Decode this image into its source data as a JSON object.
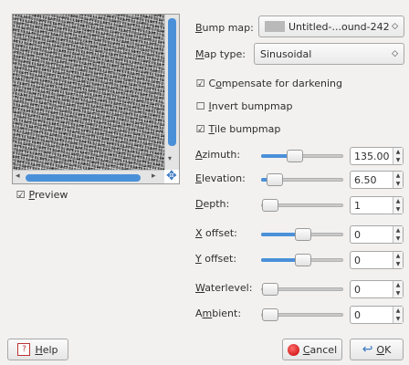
{
  "preview": {
    "checkbox_mark": "☑",
    "label_u": "P",
    "label_rest": "review"
  },
  "bump_map": {
    "label_u": "B",
    "label_rest": "ump map:",
    "value": "Untitled-...ound-242",
    "arrow": "◇"
  },
  "map_type": {
    "label_u": "M",
    "label_rest": "ap type:",
    "value": "Sinusoidal",
    "arrow": "◇"
  },
  "options": [
    {
      "mark": "☑",
      "pre": "C",
      "u": "o",
      "post": "mpensate for darkening"
    },
    {
      "mark": "☐",
      "pre": "",
      "u": "I",
      "post": "nvert bumpmap"
    },
    {
      "mark": "☑",
      "pre": "",
      "u": "T",
      "post": "ile bumpmap"
    }
  ],
  "params": [
    {
      "pre": "",
      "u": "A",
      "post": "zimuth:",
      "value": "135.00",
      "level": 0.38
    },
    {
      "pre": "",
      "u": "E",
      "post": "levation:",
      "value": "6.50",
      "level": 0.07
    },
    {
      "pre": "",
      "u": "D",
      "post": "epth:",
      "value": "1",
      "level": 0.0
    },
    {
      "pre": "",
      "u": "X",
      "post": " offset:",
      "value": "0",
      "level": 0.5
    },
    {
      "pre": "",
      "u": "Y",
      "post": " offset:",
      "value": "0",
      "level": 0.5
    },
    {
      "pre": "",
      "u": "W",
      "post": "aterlevel:",
      "value": "0",
      "level": 0.0
    },
    {
      "pre": "A",
      "u": "m",
      "post": "bient:",
      "value": "0",
      "level": 0.0
    }
  ],
  "buttons": {
    "help_u": "H",
    "help_rest": "elp",
    "cancel_u": "C",
    "cancel_rest": "ancel",
    "ok_u": "O",
    "ok_rest": "K"
  },
  "icons": {
    "spin_up": "▲",
    "spin_down": "▼",
    "scroll_left": "◂",
    "scroll_right": "▸",
    "scroll_down": "▾",
    "navigate": "✥",
    "ok": "↩"
  },
  "colors": {
    "accent": "#4a90d9",
    "cancel_red": "#c40000"
  }
}
